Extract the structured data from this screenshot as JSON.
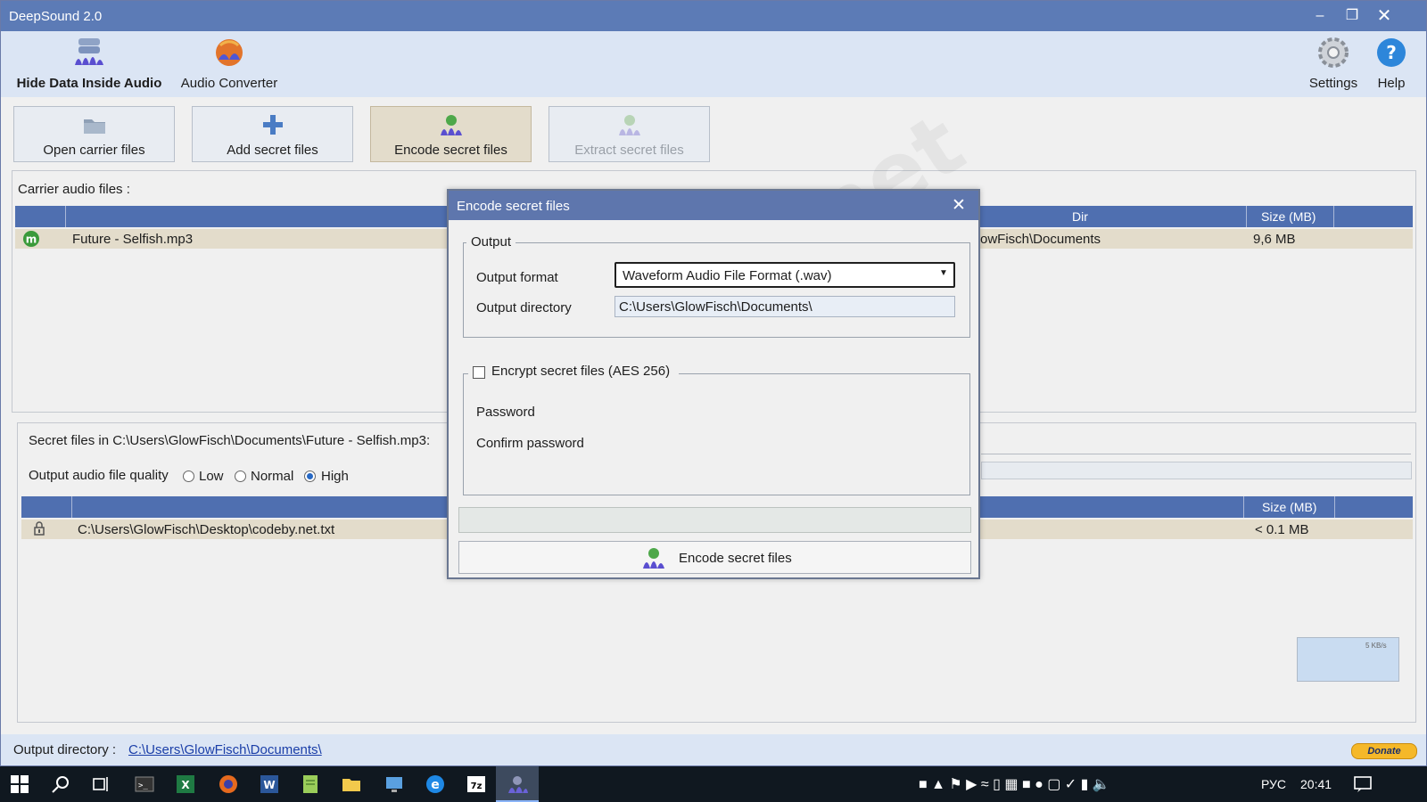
{
  "window": {
    "title": "DeepSound 2.0"
  },
  "ribbon": {
    "hide_data": "Hide Data Inside Audio",
    "converter": "Audio Converter",
    "settings": "Settings",
    "help": "Help"
  },
  "toolbar": {
    "open": "Open carrier files",
    "add": "Add secret files",
    "encode": "Encode secret files",
    "extract": "Extract secret files"
  },
  "carrier": {
    "label": "Carrier audio files :",
    "columns": {
      "dir": "Dir",
      "size": "Size (MB)"
    },
    "rows": [
      {
        "name": "Future - Selfish.mp3",
        "dir": "owFisch\\Documents",
        "size": "9,6 MB"
      }
    ]
  },
  "secret": {
    "label": "Secret files in C:\\Users\\GlowFisch\\Documents\\Future - Selfish.mp3:",
    "quality_label": "Output audio file quality",
    "quality_options": [
      "Low",
      "Normal",
      "High"
    ],
    "quality_selected": "High",
    "columns": {
      "size": "Size (MB)"
    },
    "rows": [
      {
        "path": "C:\\Users\\GlowFisch\\Desktop\\codeby.net.txt",
        "size": "< 0.1 MB"
      }
    ]
  },
  "dialog": {
    "title": "Encode secret files",
    "output_legend": "Output",
    "format_label": "Output format",
    "format_value": "Waveform Audio File Format (.wav)",
    "directory_label": "Output directory",
    "directory_value": "C:\\Users\\GlowFisch\\Documents\\",
    "encrypt_label": "Encrypt secret files (AES 256)",
    "encrypt_checked": false,
    "password_label": "Password",
    "confirm_label": "Confirm password",
    "encode_button": "Encode secret files"
  },
  "status": {
    "label": "Output directory :",
    "path": "C:\\Users\\GlowFisch\\Documents\\",
    "donate": "Donate"
  },
  "netwidget": {
    "speed": "5 KB/s"
  },
  "watermark": "codeby.net",
  "taskbar": {
    "lang": "РУС",
    "time": "20:41"
  },
  "colors": {
    "titlebar": "#5c7bb6",
    "header": "#4f6fb0",
    "row_highlight": "#e3dccb",
    "ribbon": "#dbe5f4"
  }
}
